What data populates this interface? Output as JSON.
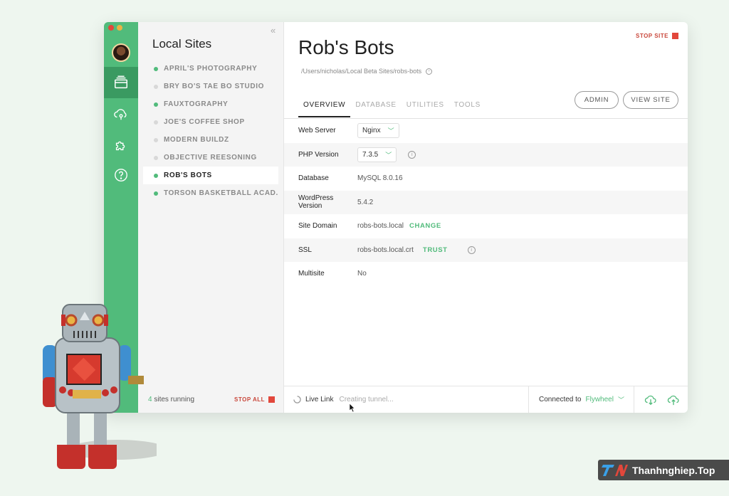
{
  "window": {
    "traffic_colors": [
      "#e2473b",
      "#e9b444",
      "#51bb7b"
    ]
  },
  "sidebar": {
    "title": "Local Sites",
    "sites": [
      {
        "label": "APRIL'S PHOTOGRAPHY",
        "running": true
      },
      {
        "label": "BRY BO'S TAE BO STUDIO",
        "running": false
      },
      {
        "label": "FAUXTOGRAPHY",
        "running": true
      },
      {
        "label": "JOE'S COFFEE SHOP",
        "running": false
      },
      {
        "label": "MODERN BUILDZ",
        "running": false
      },
      {
        "label": "OBJECTIVE REESONING",
        "running": false
      },
      {
        "label": "ROB'S BOTS",
        "running": true,
        "selected": true
      },
      {
        "label": "TORSON BASKETBALL ACAD...",
        "running": true
      }
    ],
    "running_count": "4",
    "running_text": "sites running",
    "stop_all_label": "STOP ALL"
  },
  "site": {
    "name": "Rob's Bots",
    "path": "/Users/nicholas/Local Beta Sites/robs-bots",
    "stop_label": "STOP SITE"
  },
  "tabs": [
    "OVERVIEW",
    "DATABASE",
    "UTILITIES",
    "TOOLS"
  ],
  "actions": {
    "admin_label": "ADMIN",
    "view_site_label": "VIEW SITE"
  },
  "overview": {
    "web_server_label": "Web Server",
    "web_server_value": "Nginx",
    "php_label": "PHP Version",
    "php_value": "7.3.5",
    "database_label": "Database",
    "database_value": "MySQL 8.0.16",
    "wp_label": "WordPress Version",
    "wp_value": "5.4.2",
    "domain_label": "Site Domain",
    "domain_value": "robs-bots.local",
    "domain_action": "CHANGE",
    "ssl_label": "SSL",
    "ssl_value": "robs-bots.local.crt",
    "ssl_action": "TRUST",
    "multisite_label": "Multisite",
    "multisite_value": "No"
  },
  "footer": {
    "live_link_label": "Live Link",
    "live_link_status": "Creating tunnel...",
    "connected_prefix": "Connected to",
    "connected_service": "Flywheel"
  },
  "watermark": {
    "text": "Thanhnghiep.Top"
  },
  "colors": {
    "accent": "#51bb7b",
    "accent_dark": "#3a9a61",
    "stop": "#e2473b",
    "idle_dot": "#d8d8d8"
  }
}
